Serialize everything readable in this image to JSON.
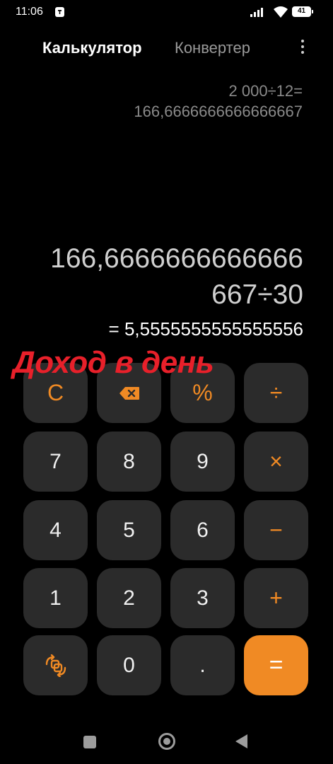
{
  "status_bar": {
    "time": "11:06",
    "battery": "41"
  },
  "tabs": {
    "calculator": "Калькулятор",
    "converter": "Конвертер"
  },
  "history": {
    "expression": "2 000÷12=",
    "result": "166,6666666666666667"
  },
  "display": {
    "expression_line1": "166,6666666666666",
    "expression_line2": "667÷30",
    "preview_result": "= 5,5555555555555556"
  },
  "annotation": {
    "text": "Доход в день",
    "color": "#e8202a"
  },
  "keypad": {
    "clear": "C",
    "percent": "%",
    "divide": "÷",
    "seven": "7",
    "eight": "8",
    "nine": "9",
    "multiply": "×",
    "four": "4",
    "five": "5",
    "six": "6",
    "minus": "−",
    "one": "1",
    "two": "2",
    "three": "3",
    "plus": "+",
    "zero": "0",
    "decimal": ".",
    "equals": "="
  },
  "colors": {
    "accent": "#f08a24",
    "key_background": "#2b2b2b",
    "background": "#000000"
  },
  "icons": {
    "backspace": "backspace-icon",
    "mode_switch": "mode-switch-icon",
    "menu": "more-vertical-icon"
  }
}
